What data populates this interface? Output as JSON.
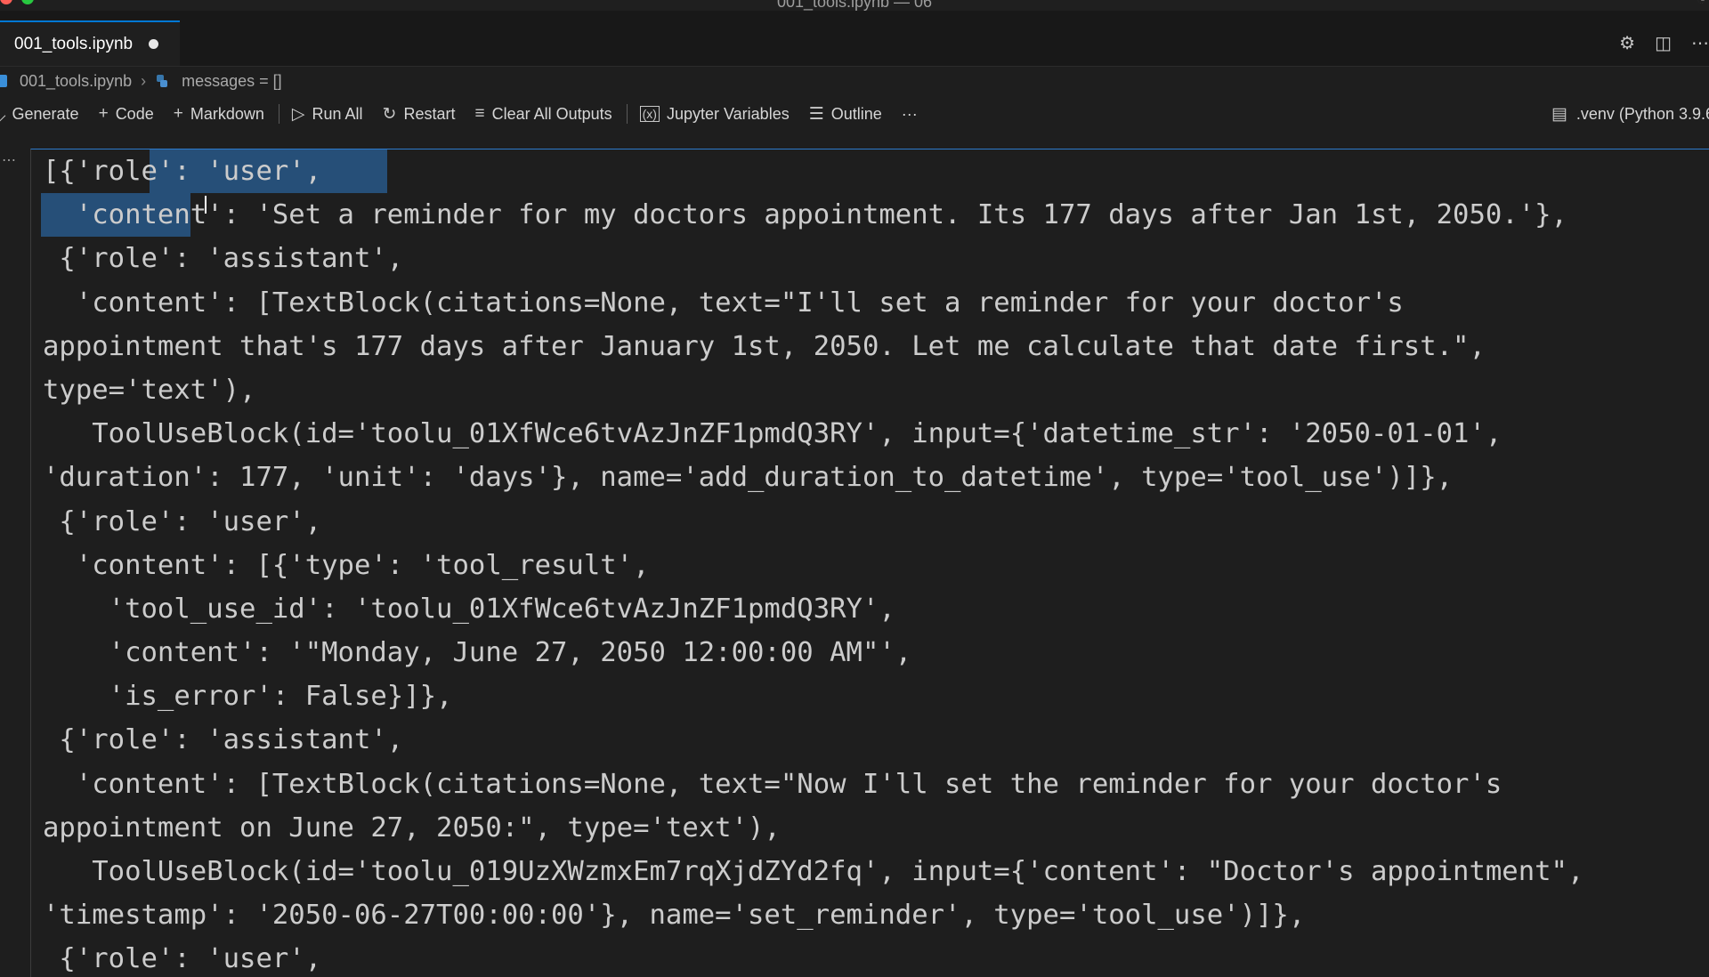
{
  "window": {
    "title": "001_tools.ipynb — 06"
  },
  "tab": {
    "label": "001_tools.ipynb"
  },
  "breadcrumb": {
    "file": "001_tools.ipynb",
    "symbol": "messages = []"
  },
  "toolbar": {
    "generate": "Generate",
    "code": "Code",
    "markdown": "Markdown",
    "run_all": "Run All",
    "restart": "Restart",
    "clear_all_outputs": "Clear All Outputs",
    "jupyter_variables": "Jupyter Variables",
    "outline": "Outline",
    "more": "···",
    "kernel": ".venv (Python 3.9.6"
  },
  "output": {
    "lines": [
      "[{'role': 'user',",
      "  'content': 'Set a reminder for my doctors appointment. Its 177 days after Jan 1st, 2050.'},",
      " {'role': 'assistant',",
      "  'content': [TextBlock(citations=None, text=\"I'll set a reminder for your doctor's",
      "appointment that's 177 days after January 1st, 2050. Let me calculate that date first.\",",
      "type='text'),",
      "   ToolUseBlock(id='toolu_01XfWce6tvAzJnZF1pmdQ3RY', input={'datetime_str': '2050-01-01',",
      "'duration': 177, 'unit': 'days'}, name='add_duration_to_datetime', type='tool_use')]},",
      " {'role': 'user',",
      "  'content': [{'type': 'tool_result',",
      "    'tool_use_id': 'toolu_01XfWce6tvAzJnZF1pmdQ3RY',",
      "    'content': '\"Monday, June 27, 2050 12:00:00 AM\"',",
      "    'is_error': False}]},",
      " {'role': 'assistant',",
      "  'content': [TextBlock(citations=None, text=\"Now I'll set the reminder for your doctor's",
      "appointment on June 27, 2050:\", type='text'),",
      "   ToolUseBlock(id='toolu_019UzXWzmxEm7rqXjdZYd2fq', input={'content': \"Doctor's appointment\",",
      "'timestamp': '2050-06-27T00:00:00'}, name='set_reminder', type='tool_use')]},",
      " {'role': 'user',"
    ]
  }
}
